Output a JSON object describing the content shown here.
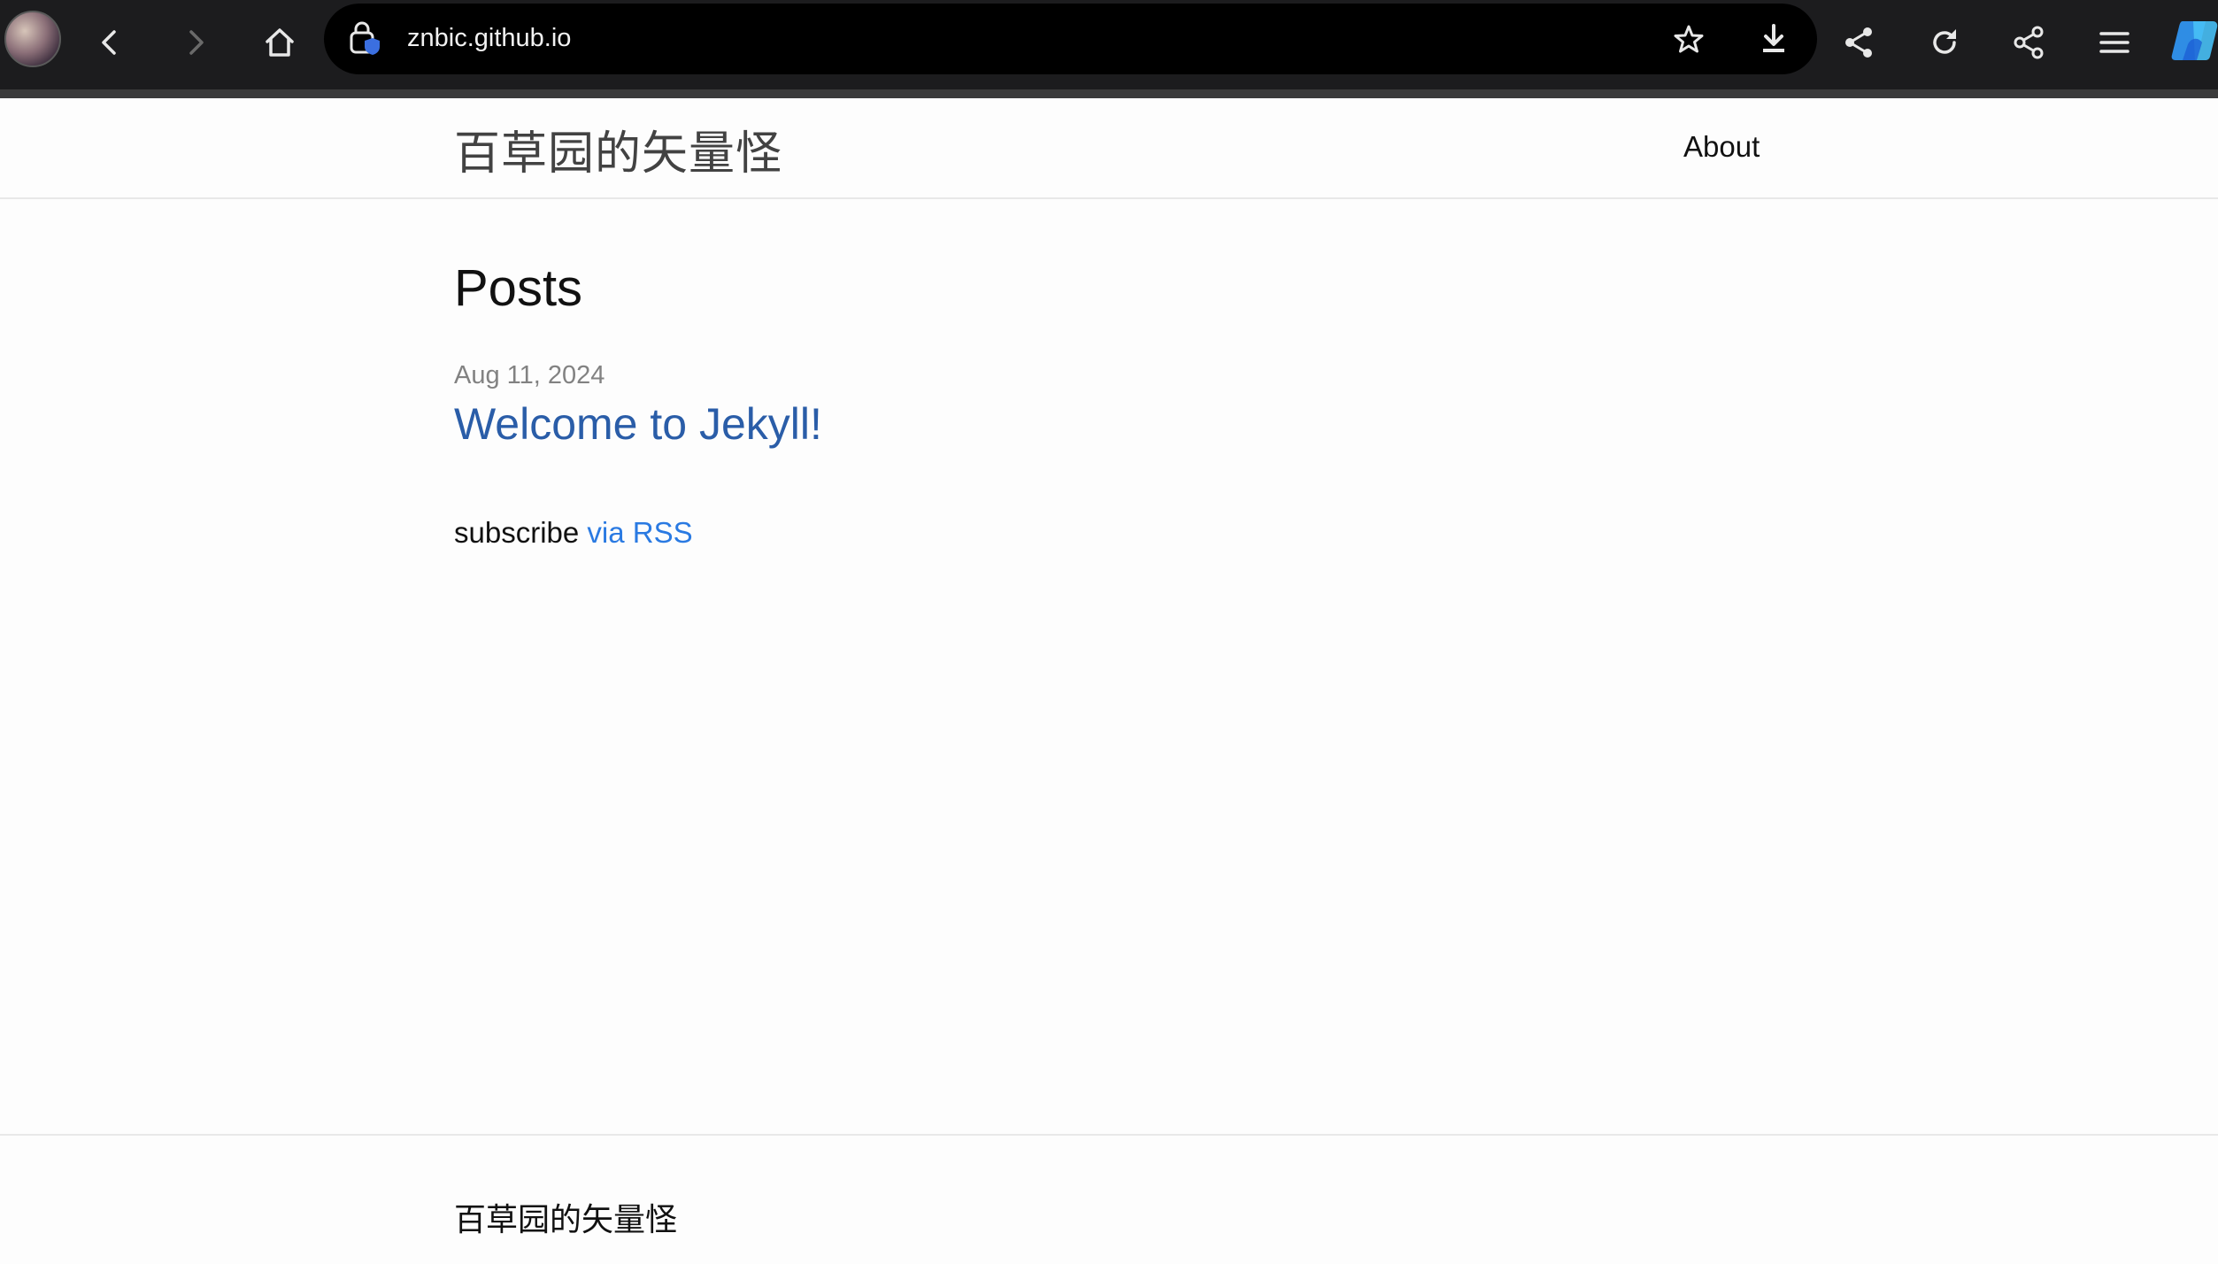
{
  "browser": {
    "url": "znbic.github.io",
    "icons": [
      "avatar",
      "back-icon",
      "forward-icon",
      "home-icon",
      "site-info-icon",
      "favorite-star-icon",
      "download-icon",
      "share-icon",
      "reload-icon",
      "share-nodes-icon",
      "menu-icon",
      "copilot-icon"
    ]
  },
  "header": {
    "site_title": "百草园的矢量怪",
    "nav": {
      "about": "About"
    }
  },
  "main": {
    "heading": "Posts",
    "posts": [
      {
        "date": "Aug 11, 2024",
        "title": "Welcome to Jekyll!"
      }
    ],
    "subscribe_text": "subscribe",
    "rss_link": "via RSS"
  },
  "footer": {
    "heading": "百草园的矢量怪"
  },
  "colors": {
    "toolbar_bg": "#1c1c1e",
    "link": "#2a7ae2",
    "post_title": "#2a5da8",
    "meta": "#828282"
  }
}
